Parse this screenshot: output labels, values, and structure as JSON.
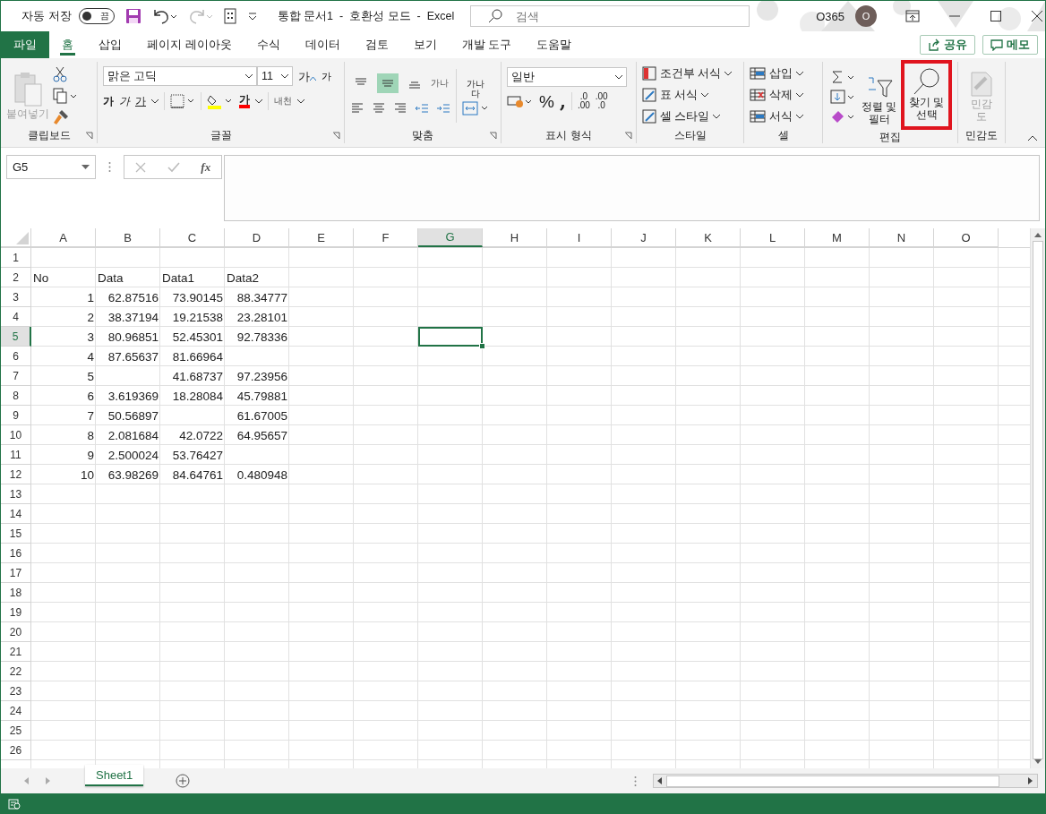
{
  "title_bar": {
    "autosave_label": "자동 저장",
    "autosave": {
      "on": false,
      "label": "끔"
    },
    "document_title": "통합 문서1  -  호환성 모드  -  Excel",
    "search": {
      "placeholder": "검색"
    },
    "account": "O365",
    "avatar_initial": "O"
  },
  "ribbon_tabs": [
    {
      "label": "파일",
      "kind": "file",
      "selected": false
    },
    {
      "label": "홈",
      "kind": "tab",
      "selected": true
    },
    {
      "label": "삽입",
      "kind": "tab",
      "selected": false
    },
    {
      "label": "페이지 레이아웃",
      "kind": "tab",
      "selected": false
    },
    {
      "label": "수식",
      "kind": "tab",
      "selected": false
    },
    {
      "label": "데이터",
      "kind": "tab",
      "selected": false
    },
    {
      "label": "검토",
      "kind": "tab",
      "selected": false
    },
    {
      "label": "보기",
      "kind": "tab",
      "selected": false
    },
    {
      "label": "개발 도구",
      "kind": "tab",
      "selected": false
    },
    {
      "label": "도움말",
      "kind": "tab",
      "selected": false
    }
  ],
  "share_button": "공유",
  "comments_button": "메모",
  "clipboard": {
    "paste": "붙여넣기",
    "paste_disabled": true,
    "label": "클립보드"
  },
  "font": {
    "name": "맑은 고딕",
    "size": "11",
    "grow": "가",
    "shrink": "가",
    "bold": "가",
    "italic": "가",
    "underline": "가",
    "font_color": "가",
    "phonetic": "내천",
    "label": "글꼴"
  },
  "alignment": {
    "orientation": "가나",
    "wrap_lines": [
      "가나",
      "다"
    ],
    "vertical": [
      {
        "selected": false
      },
      {
        "selected": true
      },
      {
        "selected": false
      }
    ],
    "label": "맞춤"
  },
  "number": {
    "format": "일반",
    "percent": "%",
    "comma": ",",
    "increase_decimal": [
      ".0",
      ".00"
    ],
    "decrease_decimal": [
      ".00",
      ".0"
    ],
    "label": "표시 형식"
  },
  "styles": {
    "items": [
      "조건부 서식",
      "표 서식",
      "셀 스타일"
    ],
    "label": "스타일"
  },
  "cells": {
    "items": [
      "삽입",
      "삭제",
      "서식"
    ],
    "label": "셀"
  },
  "editing": {
    "sort_filter": [
      "정렬 및",
      "필터"
    ],
    "find_select": {
      "lines": [
        "찾기 및",
        "선택"
      ],
      "highlighted": true
    },
    "label": "편집"
  },
  "sensitivity": {
    "lines": [
      "민감",
      "도"
    ],
    "disabled": true,
    "label": "민감도"
  },
  "formula_bar": {
    "name_box": "G5",
    "function_label": "fx"
  },
  "grid": {
    "columns": [
      {
        "label": "A",
        "selected": false
      },
      {
        "label": "B",
        "selected": false
      },
      {
        "label": "C",
        "selected": false
      },
      {
        "label": "D",
        "selected": false
      },
      {
        "label": "E",
        "selected": false
      },
      {
        "label": "F",
        "selected": false
      },
      {
        "label": "G",
        "selected": true
      },
      {
        "label": "H",
        "selected": false
      },
      {
        "label": "I",
        "selected": false
      },
      {
        "label": "J",
        "selected": false
      },
      {
        "label": "K",
        "selected": false
      },
      {
        "label": "L",
        "selected": false
      },
      {
        "label": "M",
        "selected": false
      },
      {
        "label": "N",
        "selected": false
      },
      {
        "label": "O",
        "selected": false
      }
    ],
    "rows": [
      {
        "header": "1",
        "selected": false
      },
      {
        "header": "2",
        "selected": false,
        "cells": [
          {
            "value": "No",
            "kind": "text"
          },
          {
            "value": "Data",
            "kind": "text"
          },
          {
            "value": "Data1",
            "kind": "text"
          },
          {
            "value": "Data2",
            "kind": "text"
          }
        ]
      },
      {
        "header": "3",
        "selected": false,
        "cells": [
          {
            "value": "1",
            "kind": "number"
          },
          {
            "value": "62.87516",
            "kind": "number"
          },
          {
            "value": "73.90145",
            "kind": "number"
          },
          {
            "value": "88.34777",
            "kind": "number"
          }
        ]
      },
      {
        "header": "4",
        "selected": false,
        "cells": [
          {
            "value": "2",
            "kind": "number"
          },
          {
            "value": "38.37194",
            "kind": "number"
          },
          {
            "value": "19.21538",
            "kind": "number"
          },
          {
            "value": "23.28101",
            "kind": "number"
          }
        ]
      },
      {
        "header": "5",
        "selected": true,
        "cells": [
          {
            "value": "3",
            "kind": "number"
          },
          {
            "value": "80.96851",
            "kind": "number"
          },
          {
            "value": "52.45301",
            "kind": "number"
          },
          {
            "value": "92.78336",
            "kind": "number"
          }
        ]
      },
      {
        "header": "6",
        "selected": false,
        "cells": [
          {
            "value": "4",
            "kind": "number"
          },
          {
            "value": "87.65637",
            "kind": "number"
          },
          {
            "value": "81.66964",
            "kind": "number"
          },
          null
        ]
      },
      {
        "header": "7",
        "selected": false,
        "cells": [
          {
            "value": "5",
            "kind": "number"
          },
          null,
          {
            "value": "41.68737",
            "kind": "number"
          },
          {
            "value": "97.23956",
            "kind": "number"
          }
        ]
      },
      {
        "header": "8",
        "selected": false,
        "cells": [
          {
            "value": "6",
            "kind": "number"
          },
          {
            "value": "3.619369",
            "kind": "number"
          },
          {
            "value": "18.28084",
            "kind": "number"
          },
          {
            "value": "45.79881",
            "kind": "number"
          }
        ]
      },
      {
        "header": "9",
        "selected": false,
        "cells": [
          {
            "value": "7",
            "kind": "number"
          },
          {
            "value": "50.56897",
            "kind": "number"
          },
          null,
          {
            "value": "61.67005",
            "kind": "number"
          }
        ]
      },
      {
        "header": "10",
        "selected": false,
        "cells": [
          {
            "value": "8",
            "kind": "number"
          },
          {
            "value": "2.081684",
            "kind": "number"
          },
          {
            "value": "42.0722",
            "kind": "number"
          },
          {
            "value": "64.95657",
            "kind": "number"
          }
        ]
      },
      {
        "header": "11",
        "selected": false,
        "cells": [
          {
            "value": "9",
            "kind": "number"
          },
          {
            "value": "2.500024",
            "kind": "number"
          },
          {
            "value": "53.76427",
            "kind": "number"
          },
          null
        ]
      },
      {
        "header": "12",
        "selected": false,
        "cells": [
          {
            "value": "10",
            "kind": "number"
          },
          {
            "value": "63.98269",
            "kind": "number"
          },
          {
            "value": "84.64761",
            "kind": "number"
          },
          {
            "value": "0.480948",
            "kind": "number"
          }
        ]
      },
      {
        "header": "13",
        "selected": false
      },
      {
        "header": "14",
        "selected": false
      },
      {
        "header": "15",
        "selected": false
      },
      {
        "header": "16",
        "selected": false
      },
      {
        "header": "17",
        "selected": false
      },
      {
        "header": "18",
        "selected": false
      },
      {
        "header": "19",
        "selected": false
      },
      {
        "header": "20",
        "selected": false
      },
      {
        "header": "21",
        "selected": false
      },
      {
        "header": "22",
        "selected": false
      },
      {
        "header": "23",
        "selected": false
      },
      {
        "header": "24",
        "selected": false
      },
      {
        "header": "25",
        "selected": false
      },
      {
        "header": "26",
        "selected": false
      }
    ]
  },
  "sheet_tabs": [
    {
      "label": "Sheet1",
      "selected": true
    }
  ]
}
